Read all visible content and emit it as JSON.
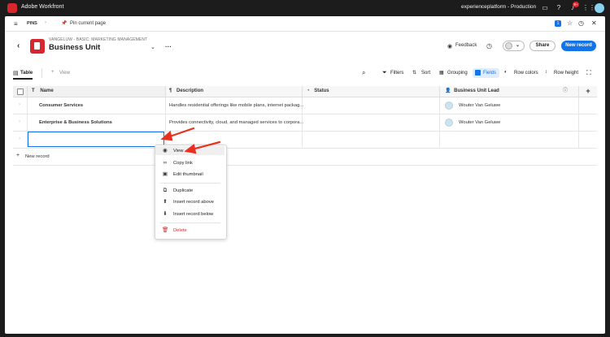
{
  "topbar": {
    "app_title": "Adobe Workfront",
    "org": "experienceplatform - Production",
    "notification_count": "9+"
  },
  "pinsbar": {
    "pins_label": "PINS",
    "pin_current_page": "Pin current page",
    "count_badge": "1"
  },
  "header": {
    "breadcrumb": "VANGELUW - BASIC: MARKETING MANAGEMENT",
    "title": "Business Unit",
    "feedback": "Feedback",
    "share": "Share",
    "new_record": "New record"
  },
  "toolbar": {
    "table_tab": "Table",
    "add_view": "View",
    "filters": "Filters",
    "sort": "Sort",
    "grouping": "Grouping",
    "fields": "Fields",
    "row_colors": "Row colors",
    "row_height": "Row height"
  },
  "table": {
    "columns": [
      "Name",
      "Description",
      "Status",
      "Business Unit Lead"
    ],
    "rows": [
      {
        "name": "Consumer Services",
        "description": "Handles residential offerings like mobile plans, internet packag...",
        "status": "",
        "lead": "Wouter Van Geluwe"
      },
      {
        "name": "Enterprise & Business Solutions",
        "description": "Provides connectivity, cloud, and managed services to corpora...",
        "status": "",
        "lead": "Wouter Van Geluwe"
      }
    ],
    "new_record": "New record"
  },
  "context_menu": {
    "items": [
      {
        "label": "View",
        "icon": "eye-icon"
      },
      {
        "label": "Copy link",
        "icon": "link-icon"
      },
      {
        "label": "Edit thumbnail",
        "icon": "image-icon"
      },
      {
        "label": "Duplicate",
        "icon": "duplicate-icon"
      },
      {
        "label": "Insert record above",
        "icon": "arrow-up-icon"
      },
      {
        "label": "Insert record below",
        "icon": "arrow-down-icon"
      },
      {
        "label": "Delete",
        "icon": "trash-icon"
      }
    ]
  },
  "colors": {
    "accent": "#1473e6",
    "brand": "#d7262d",
    "delete": "#d7262d",
    "annotation_arrow": "#e8311f"
  }
}
